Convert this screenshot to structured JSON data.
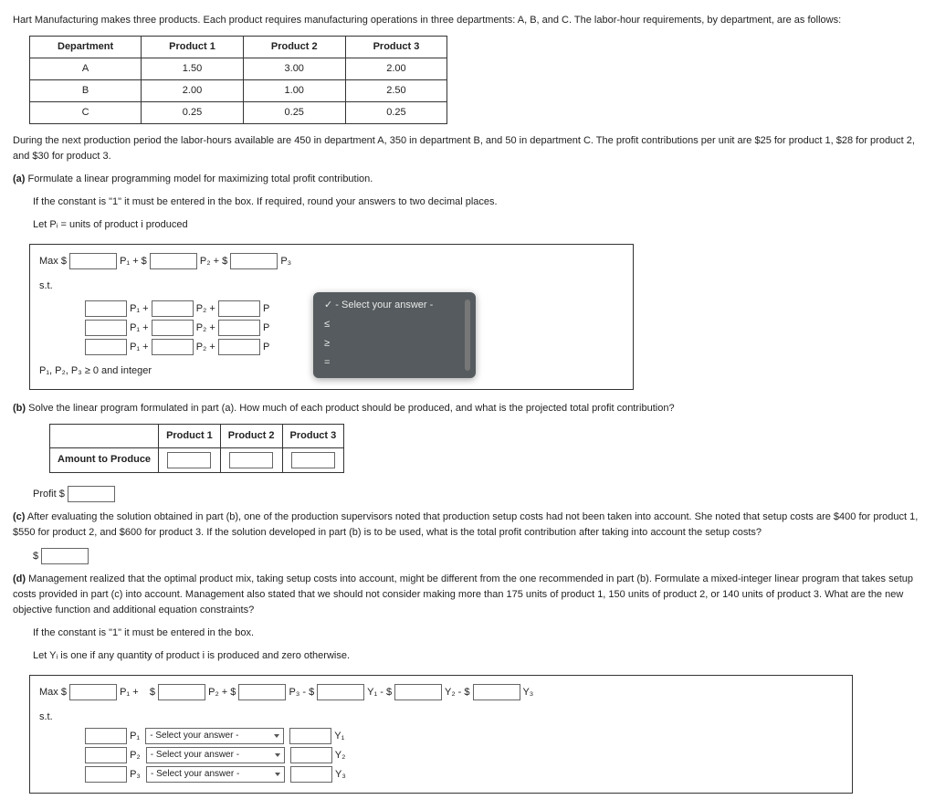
{
  "intro": "Hart Manufacturing makes three products. Each product requires manufacturing operations in three departments: A, B, and C. The labor-hour requirements, by department, are as follows:",
  "table1": {
    "headers": [
      "Department",
      "Product 1",
      "Product 2",
      "Product 3"
    ],
    "rows": [
      [
        "A",
        "1.50",
        "3.00",
        "2.00"
      ],
      [
        "B",
        "2.00",
        "1.00",
        "2.50"
      ],
      [
        "C",
        "0.25",
        "0.25",
        "0.25"
      ]
    ]
  },
  "intro2": "During the next production period the labor-hours available are 450 in department A, 350 in department B, and 50 in department C. The profit contributions per unit are $25 for product 1, $28 for product 2, and $30 for product 3.",
  "a": {
    "label": "(a)",
    "q": "Formulate a linear programming model for maximizing total profit contribution.",
    "note1": "If the constant is \"1\" it must be entered in the box. If required, round your answers to two decimal places.",
    "note2": "Let Pᵢ = units of product i produced",
    "max": "Max  $",
    "p1": "P₁  +  $",
    "p2": "P₂  +  $",
    "p3": "P₃",
    "st": "s.t.",
    "rp1": "P₁  +",
    "rp2": "P₂  +",
    "rp3t": "P",
    "nonneg": "P₁, P₂, P₃ ≥ 0 and integer",
    "dropdown": {
      "sel": "- Select your answer -",
      "opts": [
        "≤",
        "≥",
        "="
      ]
    }
  },
  "b": {
    "label": "(b)",
    "q": "Solve the linear program formulated in part (a). How much of each product should be produced, and what is the projected total profit contribution?",
    "headers": [
      "",
      "Product 1",
      "Product 2",
      "Product 3"
    ],
    "rowlabel": "Amount to Produce",
    "profit": "Profit $"
  },
  "c": {
    "label": "(c)",
    "q": "After evaluating the solution obtained in part (b), one of the production supervisors noted that production setup costs had not been taken into account. She noted that setup costs are $400 for product 1, $550 for product 2, and $600 for product 3. If the solution developed in part (b) is to be used, what is the total profit contribution after taking into account the setup costs?",
    "dollar": "$"
  },
  "d": {
    "label": "(d)",
    "q": "Management realized that the optimal product mix, taking setup costs into account, might be different from the one recommended in part (b). Formulate a mixed-integer linear program that takes setup costs provided in part (c) into account. Management also stated that we should not consider making more than 175 units of product 1, 150 units of product 2, or 140 units of product 3. What are the new objective function and additional equation constraints?",
    "note1": "If the constant is \"1\" it must be entered in the box.",
    "note2": "Let Yᵢ is one if any quantity of product i is produced and zero otherwise.",
    "max": "Max  $",
    "t_p1": "P₁   +",
    "t_ds": "$",
    "t_p2": "P₂   +  $",
    "t_p3": "P₃  -  $",
    "t_y1": "Y₁  -  $",
    "t_y2": "Y₂  -  $",
    "t_y3": "Y₃",
    "st": "s.t.",
    "r_p1": "P₁",
    "r_p2": "P₂",
    "r_p3": "P₃",
    "r_y1": "Y₁",
    "r_y2": "Y₂",
    "r_y3": "Y₃",
    "sel": "- Select your answer -"
  }
}
